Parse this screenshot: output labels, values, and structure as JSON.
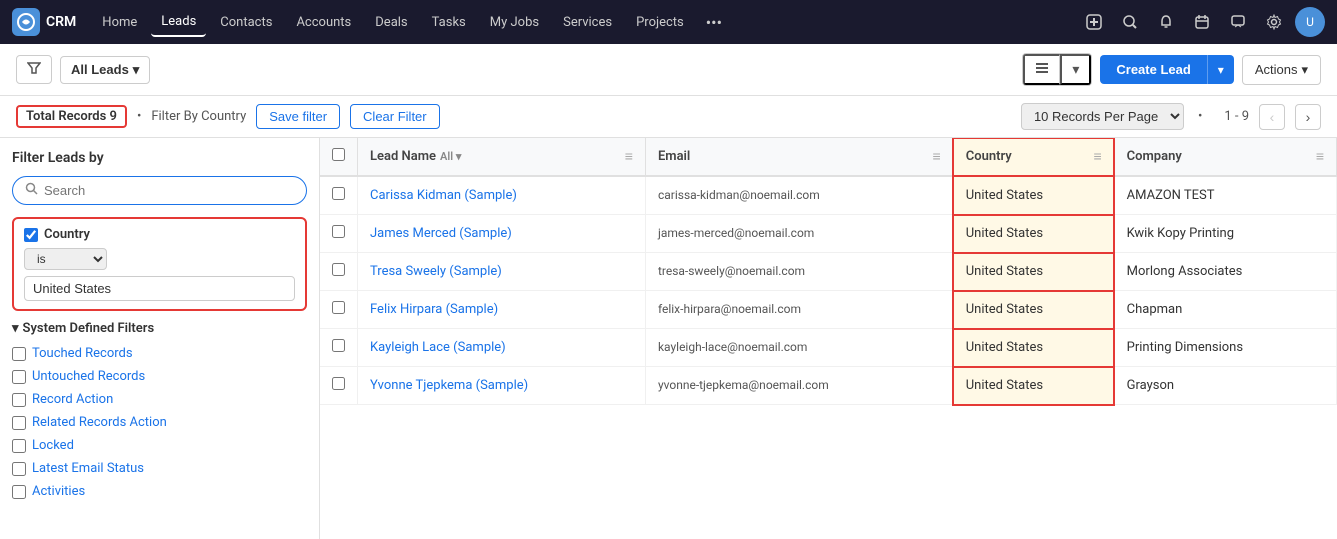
{
  "nav": {
    "logo_icon": "CRM",
    "logo_text": "CRM",
    "items": [
      {
        "label": "Home",
        "active": false
      },
      {
        "label": "Leads",
        "active": true
      },
      {
        "label": "Contacts",
        "active": false
      },
      {
        "label": "Accounts",
        "active": false
      },
      {
        "label": "Deals",
        "active": false
      },
      {
        "label": "Tasks",
        "active": false
      },
      {
        "label": "My Jobs",
        "active": false
      },
      {
        "label": "Services",
        "active": false
      },
      {
        "label": "Projects",
        "active": false
      }
    ],
    "more_icon": "•••"
  },
  "toolbar": {
    "filter_icon": "⊤",
    "all_leads_label": "All Leads",
    "create_lead_label": "Create Lead",
    "actions_label": "Actions"
  },
  "filter_bar": {
    "total_records_label": "Total Records 9",
    "filter_by_text": "Filter By Country",
    "save_filter_label": "Save filter",
    "clear_filter_label": "Clear Filter",
    "per_page_label": "10 Records Per Page",
    "pagination_info": "1 - 9"
  },
  "sidebar": {
    "title": "Filter Leads by",
    "search_placeholder": "Search",
    "filter_country": {
      "label": "Country",
      "operator": "is",
      "value": "United States"
    },
    "system_filters_title": "System Defined Filters",
    "system_filters": [
      {
        "label": "Touched Records"
      },
      {
        "label": "Untouched Records"
      },
      {
        "label": "Record Action"
      },
      {
        "label": "Related Records Action"
      },
      {
        "label": "Locked"
      },
      {
        "label": "Latest Email Status"
      },
      {
        "label": "Activities"
      }
    ]
  },
  "table": {
    "columns": [
      {
        "key": "checkbox",
        "label": ""
      },
      {
        "key": "lead_name",
        "label": "Lead Name",
        "filter": "All"
      },
      {
        "key": "email",
        "label": "Email"
      },
      {
        "key": "country",
        "label": "Country"
      },
      {
        "key": "company",
        "label": "Company"
      }
    ],
    "rows": [
      {
        "lead_name": "Carissa Kidman (Sample)",
        "email": "carissa-kidman@noemail.com",
        "country": "United States",
        "company": "AMAZON TEST"
      },
      {
        "lead_name": "James Merced (Sample)",
        "email": "james-merced@noemail.com",
        "country": "United States",
        "company": "Kwik Kopy Printing"
      },
      {
        "lead_name": "Tresa Sweely (Sample)",
        "email": "tresa-sweely@noemail.com",
        "country": "United States",
        "company": "Morlong Associates"
      },
      {
        "lead_name": "Felix Hirpara (Sample)",
        "email": "felix-hirpara@noemail.com",
        "country": "United States",
        "company": "Chapman"
      },
      {
        "lead_name": "Kayleigh Lace (Sample)",
        "email": "kayleigh-lace@noemail.com",
        "country": "United States",
        "company": "Printing Dimensions"
      },
      {
        "lead_name": "Yvonne Tjepkema (Sample)",
        "email": "yvonne-tjepkema@noemail.com",
        "country": "United States",
        "company": "Grayson"
      }
    ]
  }
}
